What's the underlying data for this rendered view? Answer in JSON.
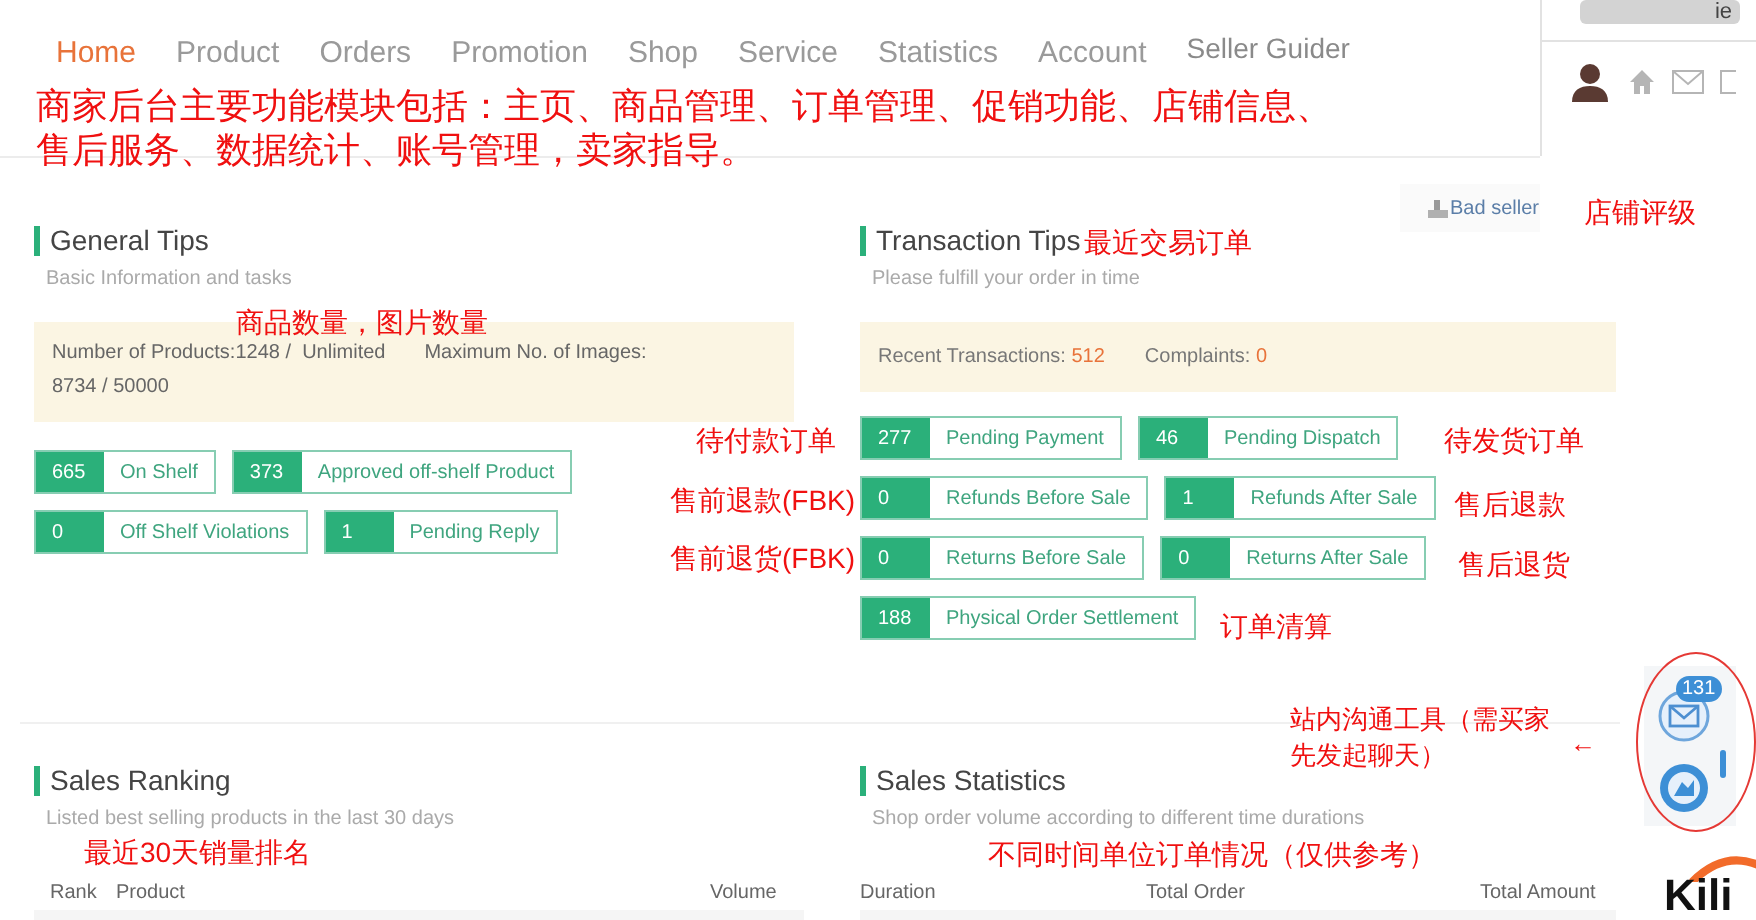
{
  "nav": [
    {
      "label": "Home",
      "selected": true
    },
    {
      "label": "Product",
      "selected": false
    },
    {
      "label": "Orders",
      "selected": false
    },
    {
      "label": "Promotion",
      "selected": false
    },
    {
      "label": "Shop",
      "selected": false
    },
    {
      "label": "Service",
      "selected": false
    },
    {
      "label": "Statistics",
      "selected": false
    },
    {
      "label": "Account",
      "selected": false
    },
    {
      "label": "Seller Guider",
      "selected": false
    }
  ],
  "account_box": {
    "text": "ie"
  },
  "seller_rating": "Bad seller",
  "general_tips": {
    "title": "General Tips",
    "subtitle": "Basic Information and tasks",
    "info_text": "Number of Products:1248 /  Unlimited       Maximum No. of Images: 8734 / 50000",
    "badge_rows": [
      [
        {
          "count": "665",
          "label": "On Shelf"
        },
        {
          "count": "373",
          "label": "Approved off-shelf Product"
        }
      ],
      [
        {
          "count": "0",
          "label": "Off Shelf Violations"
        },
        {
          "count": "1",
          "label": "Pending Reply"
        }
      ]
    ]
  },
  "transaction_tips": {
    "title": "Transaction Tips",
    "subtitle": "Please fulfill your order in time",
    "info": [
      {
        "label": "Recent Transactions: ",
        "value": "512"
      },
      {
        "label": "Complaints: ",
        "value": "0"
      }
    ],
    "badge_rows": [
      [
        {
          "count": "277",
          "label": "Pending Payment"
        },
        {
          "count": "46",
          "label": "Pending Dispatch"
        }
      ],
      [
        {
          "count": "0",
          "label": "Refunds Before Sale"
        },
        {
          "count": "1",
          "label": "Refunds After Sale"
        }
      ],
      [
        {
          "count": "0",
          "label": "Returns Before Sale"
        },
        {
          "count": "0",
          "label": "Returns After Sale"
        }
      ],
      [
        {
          "count": "188",
          "label": "Physical Order Settlement"
        }
      ]
    ]
  },
  "sales_ranking": {
    "title": "Sales Ranking",
    "subtitle": "Listed best selling products in the last 30 days",
    "columns": [
      "Rank",
      "Product",
      "Volume"
    ]
  },
  "sales_statistics": {
    "title": "Sales Statistics",
    "subtitle": "Shop order volume according to different time durations",
    "columns": [
      "Duration",
      "Total Order",
      "Total Amount"
    ]
  },
  "chat": {
    "unread": "131"
  },
  "logo": {
    "text": "Kili"
  },
  "annotations": [
    "商家后台主要功能模块包括：主页、商品管理、订单管理、促销功能、店铺信息、售后服务、数据统计、账号管理，卖家指导。",
    "商品数量，图片数量",
    "最近交易订单",
    "店铺评级",
    "待付款订单",
    "售前退款(FBK)",
    "售前退货(FBK)",
    "待发货订单",
    "售后退款",
    "售后退货",
    "订单清算",
    "站内沟通工具（需买家先发起聊天）",
    "←",
    "最近30天销量排名",
    "不同时间单位订单情况（仅供参考）"
  ]
}
